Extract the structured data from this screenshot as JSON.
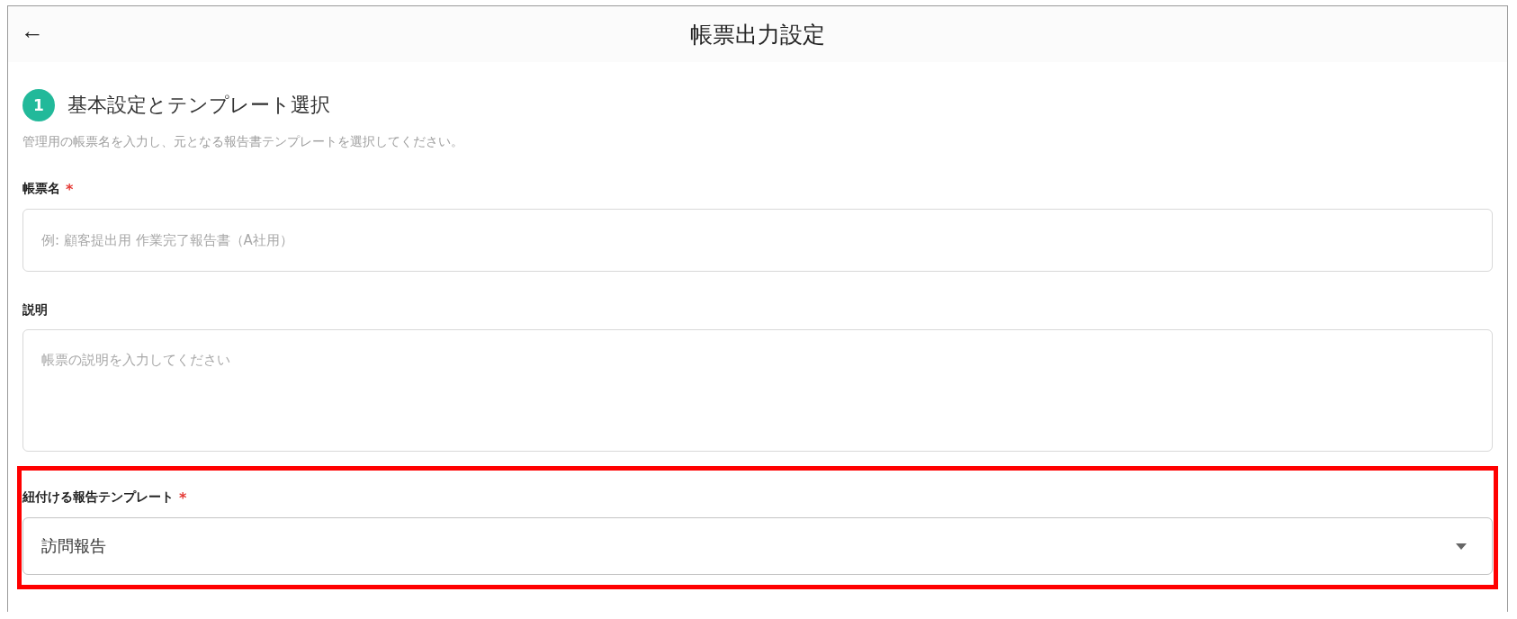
{
  "header": {
    "back": "←",
    "title": "帳票出力設定"
  },
  "section": {
    "step": "1",
    "title": "基本設定とテンプレート選択",
    "description": "管理用の帳票名を入力し、元となる報告書テンプレートを選択してください。"
  },
  "fields": [
    {
      "kind": "text",
      "label": "帳票名",
      "required_mark": "*",
      "placeholder": "例: 顧客提出用 作業完了報告書（A社用）",
      "highlighted": false
    },
    {
      "kind": "textarea",
      "label": "説明",
      "placeholder": "帳票の説明を入力してください",
      "highlighted": false
    },
    {
      "kind": "select",
      "label": "紐付ける報告テンプレート",
      "required_mark": "*",
      "value": "訪問報告",
      "highlighted": true
    }
  ]
}
